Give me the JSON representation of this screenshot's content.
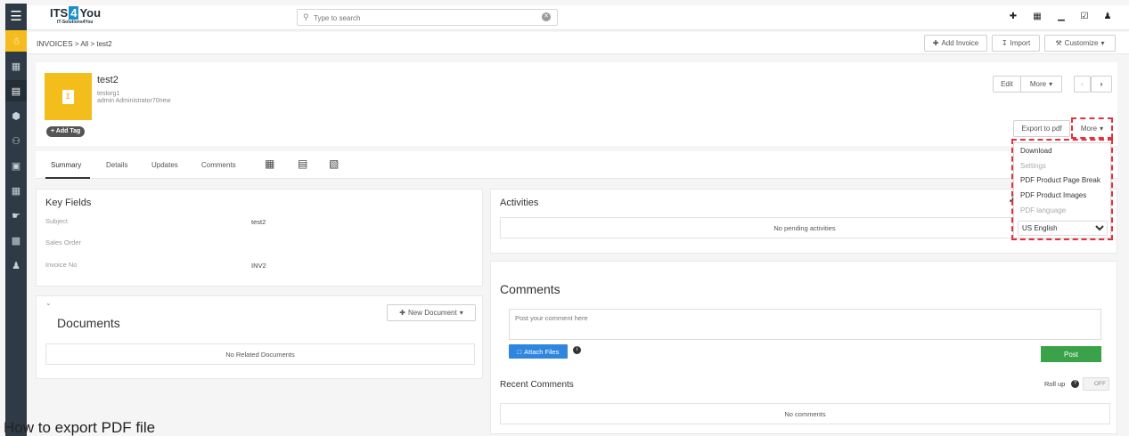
{
  "logo": {
    "brand_left": "ITS",
    "brand_four": "4",
    "brand_right": "You",
    "tagline": "IT-Solutions4You"
  },
  "search": {
    "placeholder": "Type to search"
  },
  "breadcrumb": {
    "module": "INVOICES",
    "sep1": ">",
    "all": "All",
    "sep2": ">",
    "record": "test2"
  },
  "header_buttons": {
    "add": "Add Invoice",
    "import": "Import",
    "customize": "Customize"
  },
  "record": {
    "title": "test2",
    "account": "testorg1",
    "owner": "admin Administrator70new",
    "add_tag": "+ Add Tag"
  },
  "record_actions": {
    "edit": "Edit",
    "more": "More",
    "export_pdf": "Export to pdf",
    "more2": "More"
  },
  "tabs": [
    "Summary",
    "Details",
    "Updates",
    "Comments"
  ],
  "key_fields": {
    "title": "Key Fields",
    "rows": [
      {
        "label": "Subject",
        "value": "test2"
      },
      {
        "label": "Sales Order",
        "value": ""
      },
      {
        "label": "Invoice No",
        "value": "INV2"
      }
    ]
  },
  "documents": {
    "title": "Documents",
    "new_button": "New Document",
    "empty": "No Related Documents"
  },
  "activities": {
    "title": "Activities",
    "empty": "No pending activities"
  },
  "comments": {
    "title": "Comments",
    "placeholder": "Post your comment here",
    "attach": "Attach Files",
    "post": "Post",
    "recent_title": "Recent Comments",
    "rollup": "Roll up",
    "rollup_state": "OFF",
    "empty": "No comments"
  },
  "more_menu": {
    "download": "Download",
    "settings": "Settings",
    "page_break": "PDF Product Page Break",
    "images": "PDF Product Images",
    "language_label": "PDF language",
    "language": "US English"
  },
  "caption": "How to export PDF file",
  "colors": {
    "accent_yellow": "#f3bd1c",
    "rail": "#2e3b46",
    "post_green": "#3aa34a",
    "attach_blue": "#2e86de",
    "highlight_red": "#e53040"
  }
}
